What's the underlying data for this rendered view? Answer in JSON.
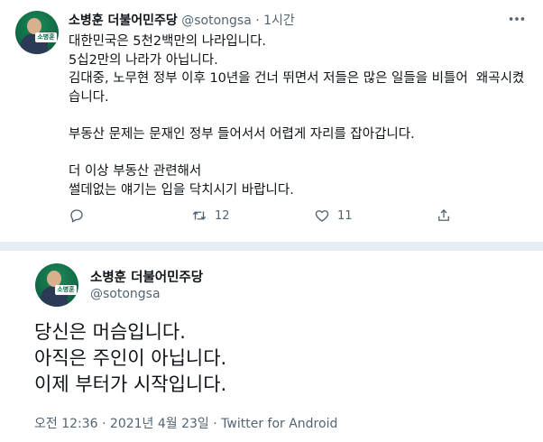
{
  "tweet1": {
    "author_name": "소병훈 더불어민주당",
    "handle_time": "@sotongsa · 1시간",
    "text": "대한민국은 5천2백만의 나라입니다.\n5십2만의 나라가 아닙니다.\n김대중, 노무현 정부 이후 10년을 건너 뛰면서 저들은 많은 일들을 비틀어  왜곡시켰습니다.\n\n부동산 문제는 문재인 정부 들어서서 어렵게 자리를 잡아갑니다.\n\n더 이상 부동산 관련해서\n썰데없는 얘기는 입을 닥치시기 바랍니다.",
    "actions": {
      "reply_count": "",
      "retweet_count": "12",
      "like_count": "11"
    },
    "icons": [
      "more-icon",
      "reply-icon",
      "retweet-icon",
      "like-icon",
      "share-icon"
    ]
  },
  "tweet2": {
    "author_name": "소병훈 더불어민주당",
    "handle": "@sotongsa",
    "text": "당신은 머슴입니다.\n아직은 주인이 아닙니다.\n이제 부터가 시작입니다.",
    "meta": "오전 12:36 · 2021년 4월 23일 · Twitter for Android"
  },
  "avatar_badge": "소병훈",
  "colors": {
    "text_primary": "#0f1419",
    "text_secondary": "#536471",
    "divider": "#e6ecf0",
    "avatar_green": "#0f6a45"
  }
}
